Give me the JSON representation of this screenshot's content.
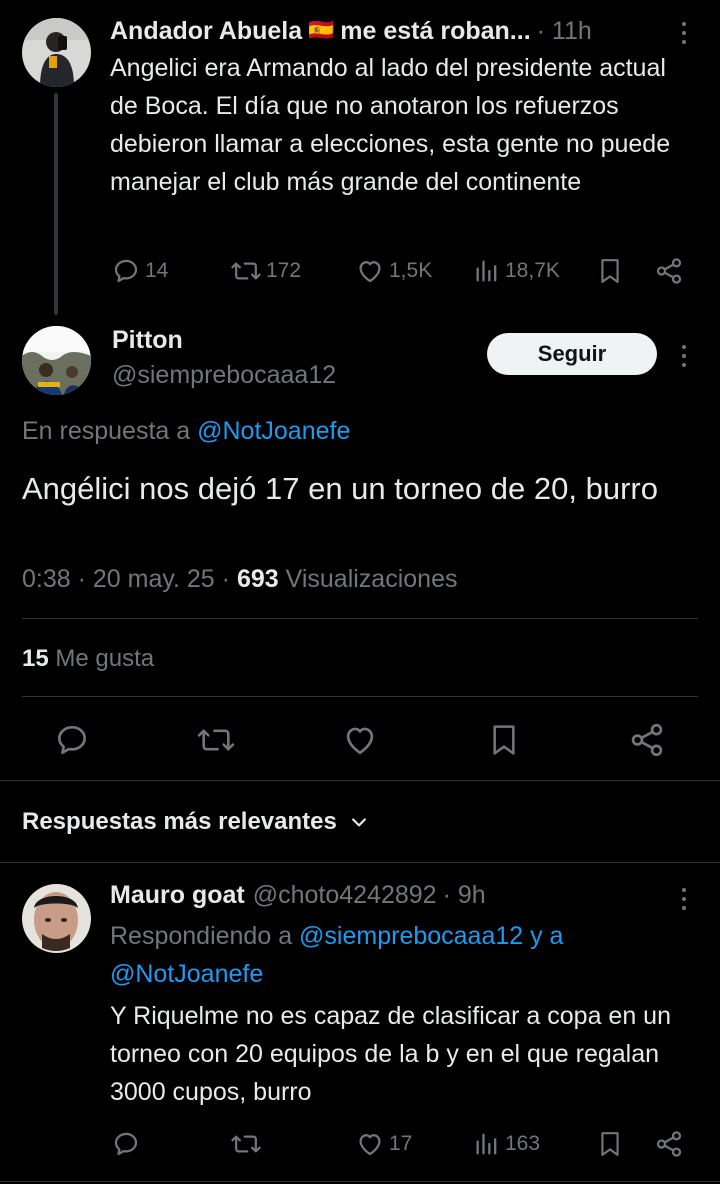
{
  "parent_tweet": {
    "display_name": "Andador Abuela",
    "flag": "🇪🇸",
    "name_suffix": "me está roban...",
    "time": "· 11h",
    "text": "Angelici era Armando al lado del presidente actual de Boca. El día que no anotaron los refuerzos debieron llamar a elecciones, esta gente no puede manejar el club más grande del continente",
    "replies": "14",
    "retweets": "172",
    "likes": "1,5K",
    "views": "18,7K"
  },
  "main_tweet": {
    "display_name": "Pitton",
    "handle": "@siemprebocaaa12",
    "follow_label": "Seguir",
    "reply_prefix": "En respuesta a",
    "reply_to": "@NotJoanefe",
    "text": "Angélici nos dejó 17 en un torneo de 20, burro",
    "timestamp": "0:38 · 20 may. 25 ·",
    "views_count": "693",
    "views_label": "Visualizaciones",
    "likes_count": "15",
    "likes_label": "Me gusta"
  },
  "replies_header": {
    "label": "Respuestas más relevantes"
  },
  "reply_tweet": {
    "display_name": "Mauro goat",
    "handle": "@choto4242892",
    "time": "· 9h",
    "replying_prefix": "Respondiendo a",
    "replying_to": "@siemprebocaaa12 y a",
    "replying_to_2": "@NotJoanefe",
    "text": "Y Riquelme no es capaz de clasificar a copa en un torneo con 20 equipos de la b y en el que regalan 3000 cupos, burro",
    "likes": "17",
    "views": "163"
  },
  "colors": {
    "background": "#000000",
    "text": "#e7e9ea",
    "muted": "#71767b",
    "link": "#1d9bf0",
    "divider": "#2f3336"
  },
  "icons": [
    "reply-icon",
    "retweet-icon",
    "like-icon",
    "views-icon",
    "bookmark-icon",
    "share-icon",
    "more-icon",
    "chevron-down-icon"
  ]
}
